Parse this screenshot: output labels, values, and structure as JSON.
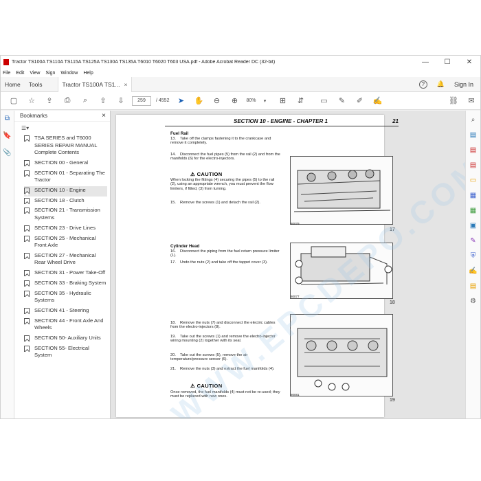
{
  "window": {
    "title": "Tractor TS100A TS110A TS115A TS125A TS130A TS135A T6010 T6020 T603 USA.pdf - Adobe Acrobat Reader DC (32-bit)",
    "minimize": "—",
    "maximize": "☐",
    "close": "✕"
  },
  "menu": [
    "File",
    "Edit",
    "View",
    "Sign",
    "Window",
    "Help"
  ],
  "tabs": {
    "home": "Home",
    "tools": "Tools",
    "doc": "Tractor TS100A TS1...",
    "close": "×",
    "sign_in": "Sign In",
    "help": "?",
    "bell": "🔔"
  },
  "toolbar": {
    "page_current": "259",
    "page_total": "/ 4552",
    "zoom": "80%"
  },
  "bookmarks": {
    "header": "Bookmarks",
    "close": "×",
    "options": "☰▾",
    "items": [
      "TSA SERIES and T6000 SERIES REPAIR MANUAL Complete Contents",
      "SECTION 00 - General",
      "SECTION 01 - Separating The Tractor",
      "SECTION 10 - Engine",
      "SECTION 18 - Clutch",
      "SECTION 21 - Transmission Systems",
      "SECTION 23 - Drive Lines",
      "SECTION 25 - Mechanical Front Axle",
      "SECTION 27 - Mechanical Rear Wheel Drive",
      "SECTION 31 - Power Take-Off",
      "SECTION 33 - Braking System",
      "SECTION 35 - Hydraulic Systems",
      "SECTION 41 - Steering",
      "SECTION 44 - Front Axle And Wheels",
      "SECTION 50- Auxiliary Units",
      "SECTION 55- Electrical System"
    ]
  },
  "page": {
    "header": "SECTION 10 - ENGINE - CHAPTER 1",
    "page_num": "21",
    "fuel_rail_heading": "Fuel Rail",
    "step13": "Take off the clamps fastening it to the crankcase and remove it completely.",
    "step14": "Disconnect the fuel pipes (5) from the rail (2) and from the manifolds (6) for the electro-injectors.",
    "caution1_label": "CAUTION",
    "caution1_text": "When locking the fittings (4) securing the pipes (5) to the rail (2), using an appropriate wrench, you must prevent the flow limiters, if fitted, (3) from turning.",
    "step15": "Remove the screws (1) and detach the rail (2).",
    "cyl_head_heading": "Cylinder Head",
    "step16": "Disconnect the piping from the fuel return pressure limiter (1).",
    "step17": "Undo the nuts (2) and take off the tappet cover (3).",
    "step18": "Remove the nuts (7) and disconnect the electric cables from the electro-injectors (8).",
    "step19": "Take out the screws (1) and remove the electro-injector wiring mounting (2) together with its seal.",
    "step20": "Take out the screws (5), remove the air temperature/pressure sensor (6).",
    "step21": "Remove the nuts (3) and extract the fuel manifolds (4).",
    "caution2_label": "CAUTION",
    "caution2_text": "Once removed, the fuel manifolds (4) must not be re-used; they must be replaced with new ones.",
    "fig17": "17",
    "fig18": "18",
    "fig19": "19",
    "fig17_code": "80079",
    "fig18_code": "80077",
    "fig19_code": "80081",
    "watermark": "WWW.EPCDEPO.COM"
  }
}
